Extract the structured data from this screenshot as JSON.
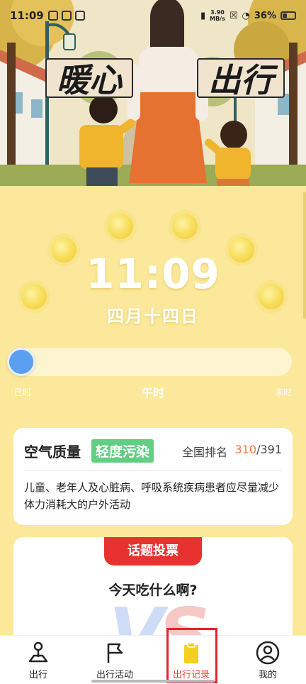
{
  "status_bar": {
    "time": "11:09",
    "speed_top": "3.90",
    "speed_bottom": "MB/s",
    "battery": "36%"
  },
  "banner": {
    "title_left": "暖心",
    "title_right": "出行"
  },
  "clock": {
    "time": "11:09",
    "date": "四月十四日"
  },
  "time_slider": {
    "start_label": "巳时",
    "current_label": "午时",
    "end_label": "未时",
    "progress": 0
  },
  "air_quality": {
    "title": "空气质量",
    "level": "轻度污染",
    "rank_label": "全国排名",
    "rank": "310",
    "rank_separator": "/",
    "rank_total": "391",
    "advice": "儿童、老年人及心脏病、呼吸系统疾病患者应尽量减少体力消耗大的户外活动"
  },
  "vote": {
    "tab_label": "话题投票",
    "question": "今天吃什么啊?",
    "vs_left": "V",
    "vs_right": "S"
  },
  "bottom_nav": {
    "items": [
      {
        "label": "出行",
        "icon": "map-pin-icon"
      },
      {
        "label": "出行活动",
        "icon": "flag-icon"
      },
      {
        "label": "出行记录",
        "icon": "clipboard-icon"
      },
      {
        "label": "我的",
        "icon": "user-icon"
      }
    ],
    "active_index": 2
  },
  "colors": {
    "background": "#fbe89a",
    "thumb": "#5a9ff0",
    "badge": "#62ce83",
    "rank_accent": "#ee7a3e",
    "vote_tab": "#e8322f",
    "nav_active": "#ec3b36"
  }
}
